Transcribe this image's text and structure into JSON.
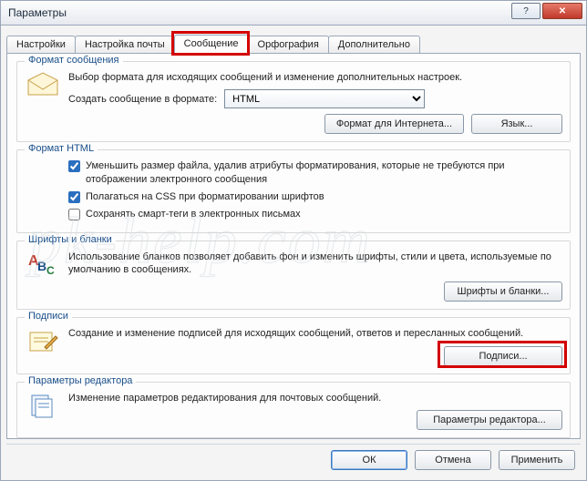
{
  "window": {
    "title": "Параметры"
  },
  "tabs": {
    "t0": "Настройки",
    "t1": "Настройка почты",
    "t2": "Сообщение",
    "t3": "Орфография",
    "t4": "Дополнительно"
  },
  "msgformat": {
    "legend": "Формат сообщения",
    "desc": "Выбор формата для исходящих сообщений и изменение дополнительных настроек.",
    "compose_label": "Создать сообщение в формате:",
    "compose_value": "HTML",
    "btn_inet": "Формат для Интернета...",
    "btn_lang": "Язык..."
  },
  "htmlformat": {
    "legend": "Формат HTML",
    "chk1": "Уменьшить размер файла, удалив атрибуты форматирования, которые не требуются при отображении электронного сообщения",
    "chk2": "Полагаться на CSS при форматировании шрифтов",
    "chk3": "Сохранять смарт-теги в электронных письмах"
  },
  "fonts": {
    "legend": "Шрифты и бланки",
    "desc": "Использование бланков позволяет добавить фон и изменить шрифты, стили и цвета, используемые по умолчанию в сообщениях.",
    "btn": "Шрифты и бланки..."
  },
  "sigs": {
    "legend": "Подписи",
    "desc": "Создание и изменение подписей для исходящих сообщений, ответов и пересланных сообщений.",
    "btn": "Подписи..."
  },
  "editor": {
    "legend": "Параметры редактора",
    "desc": "Изменение параметров редактирования для почтовых сообщений.",
    "btn": "Параметры редактора..."
  },
  "actions": {
    "ok": "ОК",
    "cancel": "Отмена",
    "apply": "Применить"
  },
  "watermark": "pk-help.com"
}
